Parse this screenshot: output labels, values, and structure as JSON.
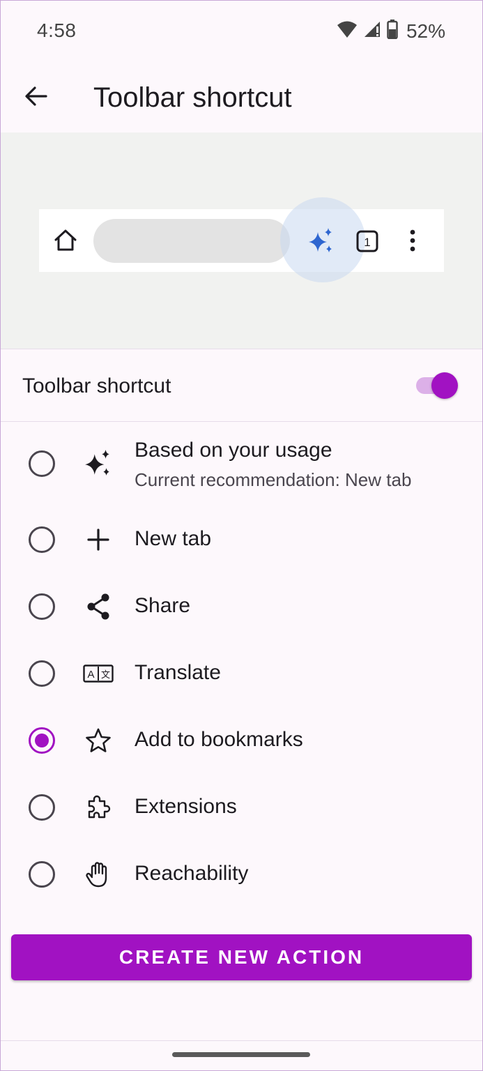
{
  "status_bar": {
    "time": "4:58",
    "battery_percent": "52%",
    "icons": [
      "wifi-icon",
      "cell-signal-icon",
      "battery-icon"
    ]
  },
  "app_bar": {
    "title": "Toolbar shortcut",
    "back_icon": "arrow-back-icon"
  },
  "preview": {
    "icons": [
      "home-icon",
      "sparkle-icon",
      "tab-switcher-icon",
      "more-vert-icon"
    ],
    "tab_count": "1",
    "highlight_color": "#2e66d0"
  },
  "toggle": {
    "label": "Toolbar shortcut",
    "enabled": true
  },
  "options": [
    {
      "label": "Based on your usage",
      "sublabel": "Current recommendation:  New tab",
      "icon": "sparkle-icon",
      "selected": false
    },
    {
      "label": "New tab",
      "icon": "plus-icon",
      "selected": false
    },
    {
      "label": "Share",
      "icon": "share-icon",
      "selected": false
    },
    {
      "label": "Translate",
      "icon": "translate-icon",
      "selected": false
    },
    {
      "label": "Add to bookmarks",
      "icon": "star-icon",
      "selected": true
    },
    {
      "label": "Extensions",
      "icon": "puzzle-icon",
      "selected": false
    },
    {
      "label": "Reachability",
      "icon": "hand-icon",
      "selected": false
    }
  ],
  "cta": {
    "label": "CREATE NEW ACTION"
  },
  "colors": {
    "accent": "#a112c2",
    "switch_track": "#dcb0e8",
    "background": "#fdf8fc",
    "preview_bg": "#f1f2f0"
  }
}
